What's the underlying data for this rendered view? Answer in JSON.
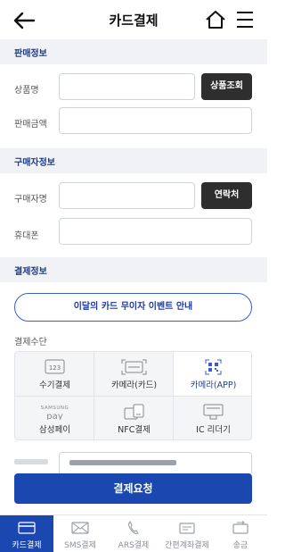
{
  "header": {
    "title": "카드결제",
    "icons": [
      "back-arrow-icon",
      "home-icon",
      "menu-icon"
    ]
  },
  "sections": {
    "sales_info": "판매정보",
    "buyer_info": "구매자정보",
    "payment_info": "결제정보"
  },
  "sales": {
    "product_label": "상품명",
    "product_value": "",
    "product_button": "상품조회",
    "amount_label": "판매금액",
    "amount_value": ""
  },
  "buyer": {
    "name_label": "구매자명",
    "name_value": "",
    "contact_button": "연락처",
    "phone_label": "휴대폰",
    "phone_value": ""
  },
  "payment": {
    "event_button": "이달의 카드 무이자 이벤트 안내",
    "method_label": "결제수단",
    "methods": [
      {
        "label": "수기결제",
        "icon": "keypad-123-icon",
        "selected": false
      },
      {
        "label": "카메라(카드)",
        "icon": "card-scan-icon",
        "selected": false
      },
      {
        "label": "카메라(APP)",
        "icon": "qr-scan-icon",
        "selected": true
      },
      {
        "label": "삼성페이",
        "icon": "samsung-pay-icon",
        "icon_text": "SAMSUNG pay",
        "selected": false
      },
      {
        "label": "NFC결제",
        "icon": "nfc-icon",
        "selected": false
      },
      {
        "label": "IC 리더기",
        "icon": "card-reader-icon",
        "selected": false
      }
    ]
  },
  "submit": {
    "label": "결제요청"
  },
  "colors": {
    "primary": "#1b47b0",
    "section_title": "#1a3d8f",
    "dark_button": "#2e2e2e"
  },
  "tabs": [
    {
      "label": "카드결제",
      "icon": "card-icon",
      "active": true
    },
    {
      "label": "SMS결제",
      "icon": "envelope-icon",
      "active": false
    },
    {
      "label": "ARS결제",
      "icon": "phone-icon",
      "active": false
    },
    {
      "label": "간편계좌결제",
      "icon": "bank-account-icon",
      "active": false
    },
    {
      "label": "송금",
      "icon": "transfer-icon",
      "active": false
    }
  ]
}
